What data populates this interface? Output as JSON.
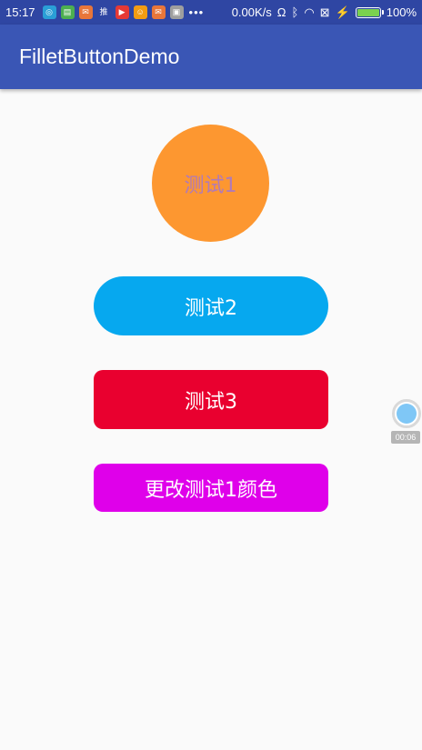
{
  "status_bar": {
    "time": "15:17",
    "notification_icons": [
      {
        "name": "browser-icon",
        "glyph": "◎",
        "color": "#2a9fd6"
      },
      {
        "name": "clipboard-icon",
        "glyph": "▤",
        "color": "#4caf50"
      },
      {
        "name": "app-icon",
        "glyph": "✉",
        "color": "#e8763a"
      },
      {
        "name": "recommend-icon",
        "glyph": "推",
        "color": "#2f46a3"
      },
      {
        "name": "play-store-icon",
        "glyph": "▶",
        "color": "#e53935"
      },
      {
        "name": "game-icon",
        "glyph": "☺",
        "color": "#f39c12"
      },
      {
        "name": "mail-icon",
        "glyph": "✉",
        "color": "#e8763a"
      },
      {
        "name": "photo-icon",
        "glyph": "▣",
        "color": "#9e9e9e"
      }
    ],
    "more_indicator": "•••",
    "network_speed": "0.00K/s",
    "headphone_icon": "Ω",
    "bluetooth_icon": "ᛒ",
    "wifi_icon": "◠",
    "sim_icon": "⊠",
    "charging_icon": "⚡",
    "battery_level": 1.0,
    "battery_percent": "100%"
  },
  "app_bar": {
    "title": "FilletButtonDemo",
    "color": "#3a56b5"
  },
  "buttons": {
    "circle": {
      "label": "测试1",
      "bg_color": "#fd9730"
    },
    "pill": {
      "label": "测试2",
      "bg_color": "#06a8ef"
    },
    "rounded": {
      "label": "测试3",
      "bg_color": "#e9002f"
    },
    "change_color": {
      "label": "更改测试1颜色",
      "bg_color": "#df00ea"
    }
  },
  "floating_timer": {
    "time": "00:06"
  }
}
